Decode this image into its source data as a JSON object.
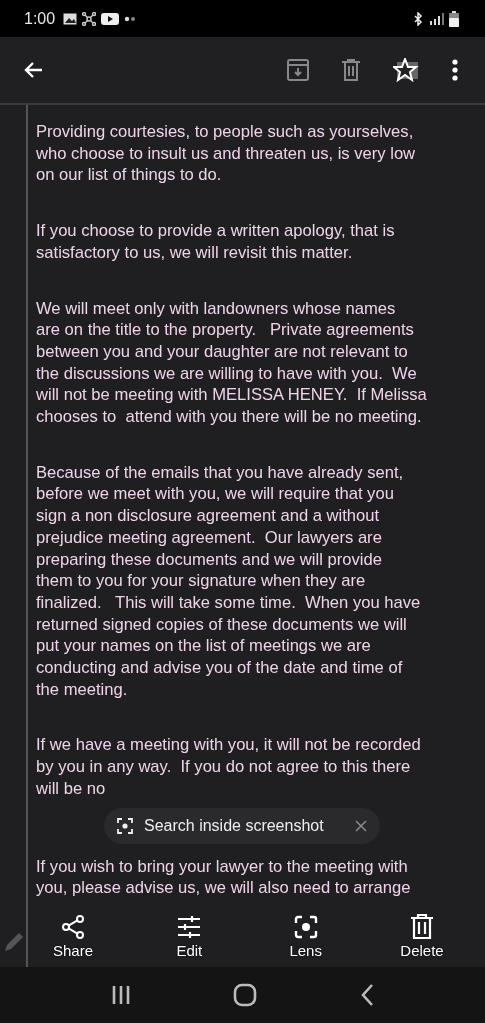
{
  "status_bar": {
    "time": "1:00"
  },
  "message": {
    "paragraphs": [
      {
        "lines": [
          "Providing courtesies, to people such as yourselves,",
          "who choose to insult us and threaten us, is very low",
          "on our list of things to do."
        ]
      },
      {
        "lines": [
          "If you choose to provide a written apology, that is",
          "satisfactory to us, we will revisit this matter."
        ]
      },
      {
        "lines": [
          "We will meet only with landowners whose names",
          "are on the title to the property.   Private agreements",
          "between you and your daughter are not relevant to",
          "the discussions we are willing to have with you.  We",
          "will not be meeting with MELISSA HENEY.  If Melissa",
          "chooses to  attend with you there will be no meeting."
        ]
      },
      {
        "lines": [
          "Because of the emails that you have already sent,",
          "before we meet with you, we will require that you",
          "sign a non disclosure agreement and a without",
          "prejudice meeting agreement.  Our lawyers are",
          "preparing these documents and we will provide",
          "them to you for your signature when they are",
          "finalized.   This will take some time.  When you have",
          "returned signed copies of these documents we will",
          "put your names on the list of meetings we are",
          "conducting and advise you of the date and time of",
          "the meeting."
        ]
      },
      {
        "lines": [
          "If we have a meeting with you, it will not be recorded",
          "by you in any way.  If you do not agree to this there",
          "will be no"
        ]
      },
      {
        "lines": [
          "If you wish to bring your lawyer to the meeting with",
          "you, please advise us, we will also need to arrange"
        ]
      }
    ]
  },
  "screenshot_overlay": {
    "search_chip": {
      "label": "Search inside screenshot"
    },
    "actions": [
      {
        "kind": "share",
        "label": "Share"
      },
      {
        "kind": "edit",
        "label": "Edit"
      },
      {
        "kind": "lens",
        "label": "Lens"
      },
      {
        "kind": "delete",
        "label": "Delete"
      }
    ]
  }
}
